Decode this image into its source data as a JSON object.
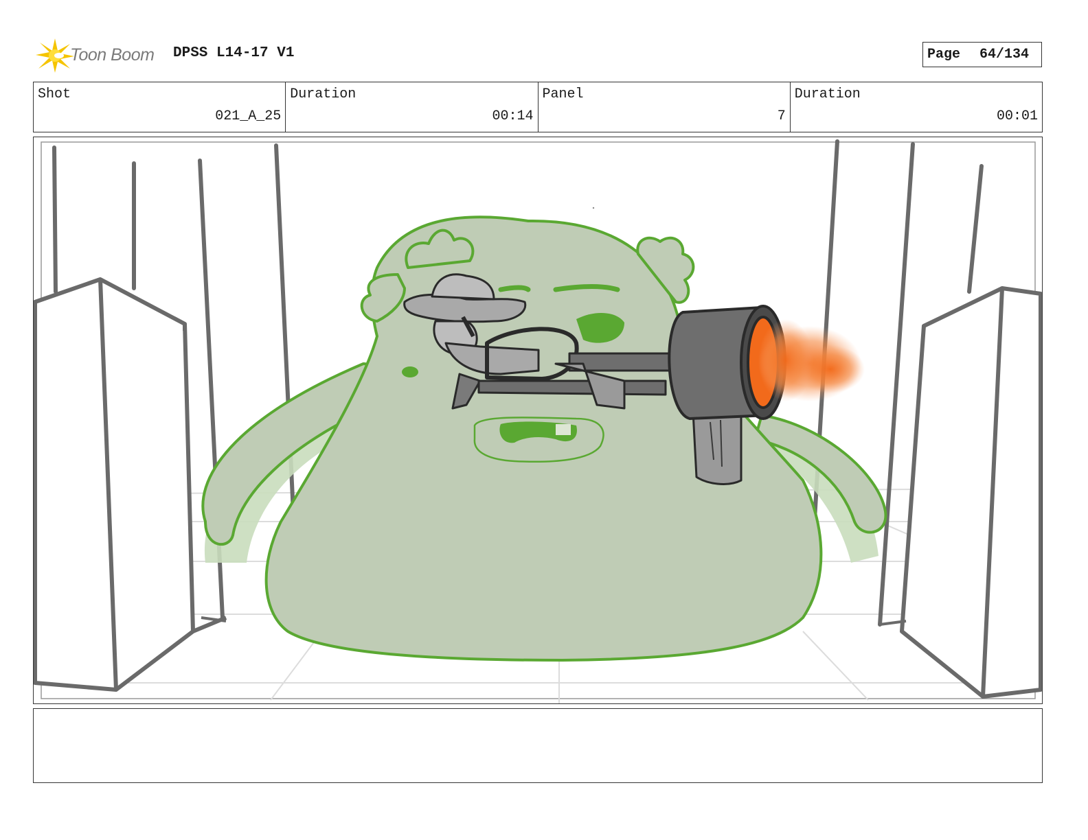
{
  "header": {
    "logo_text": "Toon Boom",
    "project_title": "DPSS L14-17 V1",
    "page_label": "Page",
    "page_value": "64/134"
  },
  "info": {
    "shot_label": "Shot",
    "shot_value": "021_A_25",
    "shot_duration_label": "Duration",
    "shot_duration_value": "00:14",
    "panel_label": "Panel",
    "panel_value": "7",
    "panel_duration_label": "Duration",
    "panel_duration_value": "00:01"
  },
  "colors": {
    "logo_star": "#f5c400",
    "monster_fill": "#bfccb5",
    "monster_outline": "#5aa832",
    "gun_gray": "#6e6e6e",
    "muzzle_flash": "#f26a1b",
    "pillar_gray": "#666666"
  }
}
